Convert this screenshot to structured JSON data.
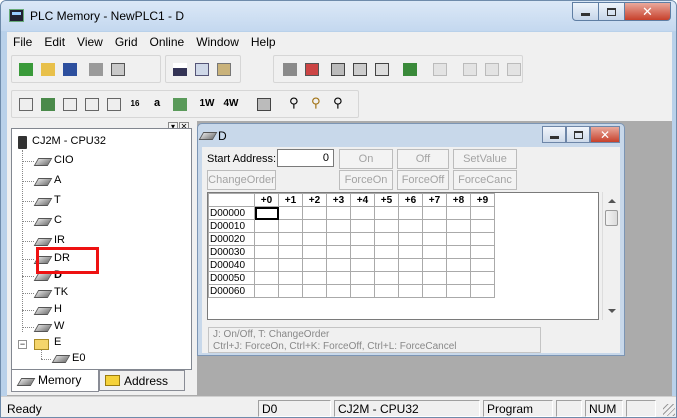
{
  "window": {
    "title": "PLC Memory - NewPLC1 - D"
  },
  "menu": [
    "File",
    "Edit",
    "View",
    "Grid",
    "Online",
    "Window",
    "Help"
  ],
  "toolbar2_labels": {
    "a": "a",
    "w1": "1W",
    "w2": "4W",
    "b16": "16"
  },
  "panel": {
    "tree": {
      "root": "CJ2M - CPU32",
      "items": [
        "CIO",
        "A",
        "T",
        "C",
        "IR",
        "DR",
        "D",
        "TK",
        "H",
        "W",
        "E",
        "E0"
      ]
    },
    "tabs": {
      "memory": "Memory",
      "address": "Address"
    }
  },
  "inner": {
    "title": "D",
    "start_address_label": "Start Address:",
    "start_address_value": "0",
    "buttons": {
      "on": "On",
      "off": "Off",
      "setvalue": "SetValue",
      "changeorder": "ChangeOrder",
      "forceon": "ForceOn",
      "forceoff": "ForceOff",
      "forcecanc": "ForceCanc"
    },
    "columns": [
      "+0",
      "+1",
      "+2",
      "+3",
      "+4",
      "+5",
      "+6",
      "+7",
      "+8",
      "+9"
    ],
    "rows": [
      "D00000",
      "D00010",
      "D00020",
      "D00030",
      "D00040",
      "D00050",
      "D00060"
    ],
    "hint_line1": "J: On/Off,  T: ChangeOrder",
    "hint_line2": "Ctrl+J: ForceOn,  Ctrl+K: ForceOff,  Ctrl+L: ForceCancel"
  },
  "status": {
    "state": "Ready",
    "address": "D0",
    "plc": "CJ2M - CPU32",
    "mode": "Program",
    "num": "NUM"
  },
  "colors": {
    "title_bar": "#c4d8ef",
    "highlight": "#e11111",
    "close_button": "#c7402b"
  }
}
